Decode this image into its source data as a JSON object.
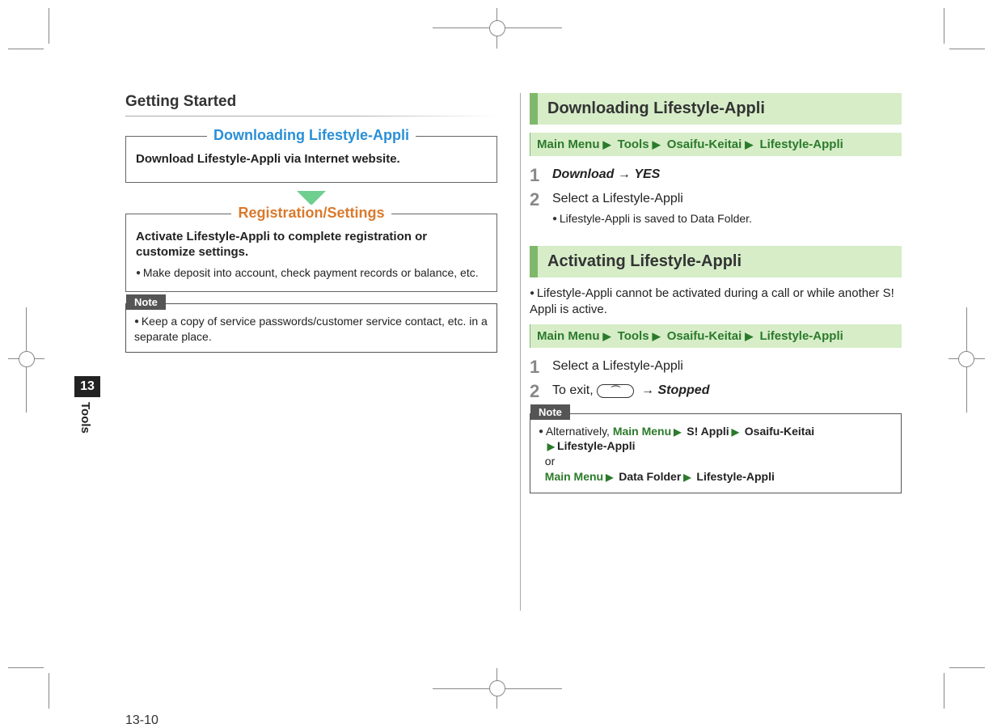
{
  "left": {
    "title": "Getting Started",
    "box1_legend": "Downloading Lifestyle-Appli",
    "box1_text": "Download Lifestyle-Appli via Internet website.",
    "box2_legend": "Registration/Settings",
    "box2_bold": "Activate Lifestyle-Appli to complete registration or customize settings.",
    "box2_sub": "Make deposit into account, check payment records or balance, etc.",
    "note_label": "Note",
    "note_text": "Keep a copy of service passwords/customer service contact, etc. in a separate place."
  },
  "right": {
    "h_download": "Downloading Lifestyle-Appli",
    "nav1": {
      "p0": "Main Menu",
      "p1": "Tools",
      "p2": "Osaifu-Keitai",
      "p3": "Lifestyle-Appli"
    },
    "d_step1_a": "Download",
    "d_step1_b": "YES",
    "d_step2": "Select a Lifestyle-Appli",
    "d_step2_sub": "Lifestyle-Appli is saved to Data Folder.",
    "h_activating": "Activating Lifestyle-Appli",
    "act_note": "Lifestyle-Appli cannot be activated during a call or while another S! Appli is active.",
    "nav2": {
      "p0": "Main Menu",
      "p1": "Tools",
      "p2": "Osaifu-Keitai",
      "p3": "Lifestyle-Appli"
    },
    "a_step1": "Select a Lifestyle-Appli",
    "a_step2_pre": "To exit, ",
    "a_step2_key": "⏜",
    "a_step2_post": "Stopped",
    "note_label": "Note",
    "note_alt_pre": "Alternatively,",
    "note_alt_path1": {
      "p0": "Main Menu",
      "p1": "S! Appli",
      "p2": "Osaifu-Keitai",
      "p3": "Lifestyle-Appli"
    },
    "note_or": "or",
    "note_alt_path2": {
      "p0": "Main Menu",
      "p1": "Data Folder",
      "p2": "Lifestyle-Appli"
    }
  },
  "tab": {
    "num": "13",
    "name": "Tools"
  },
  "folio": "13-10"
}
